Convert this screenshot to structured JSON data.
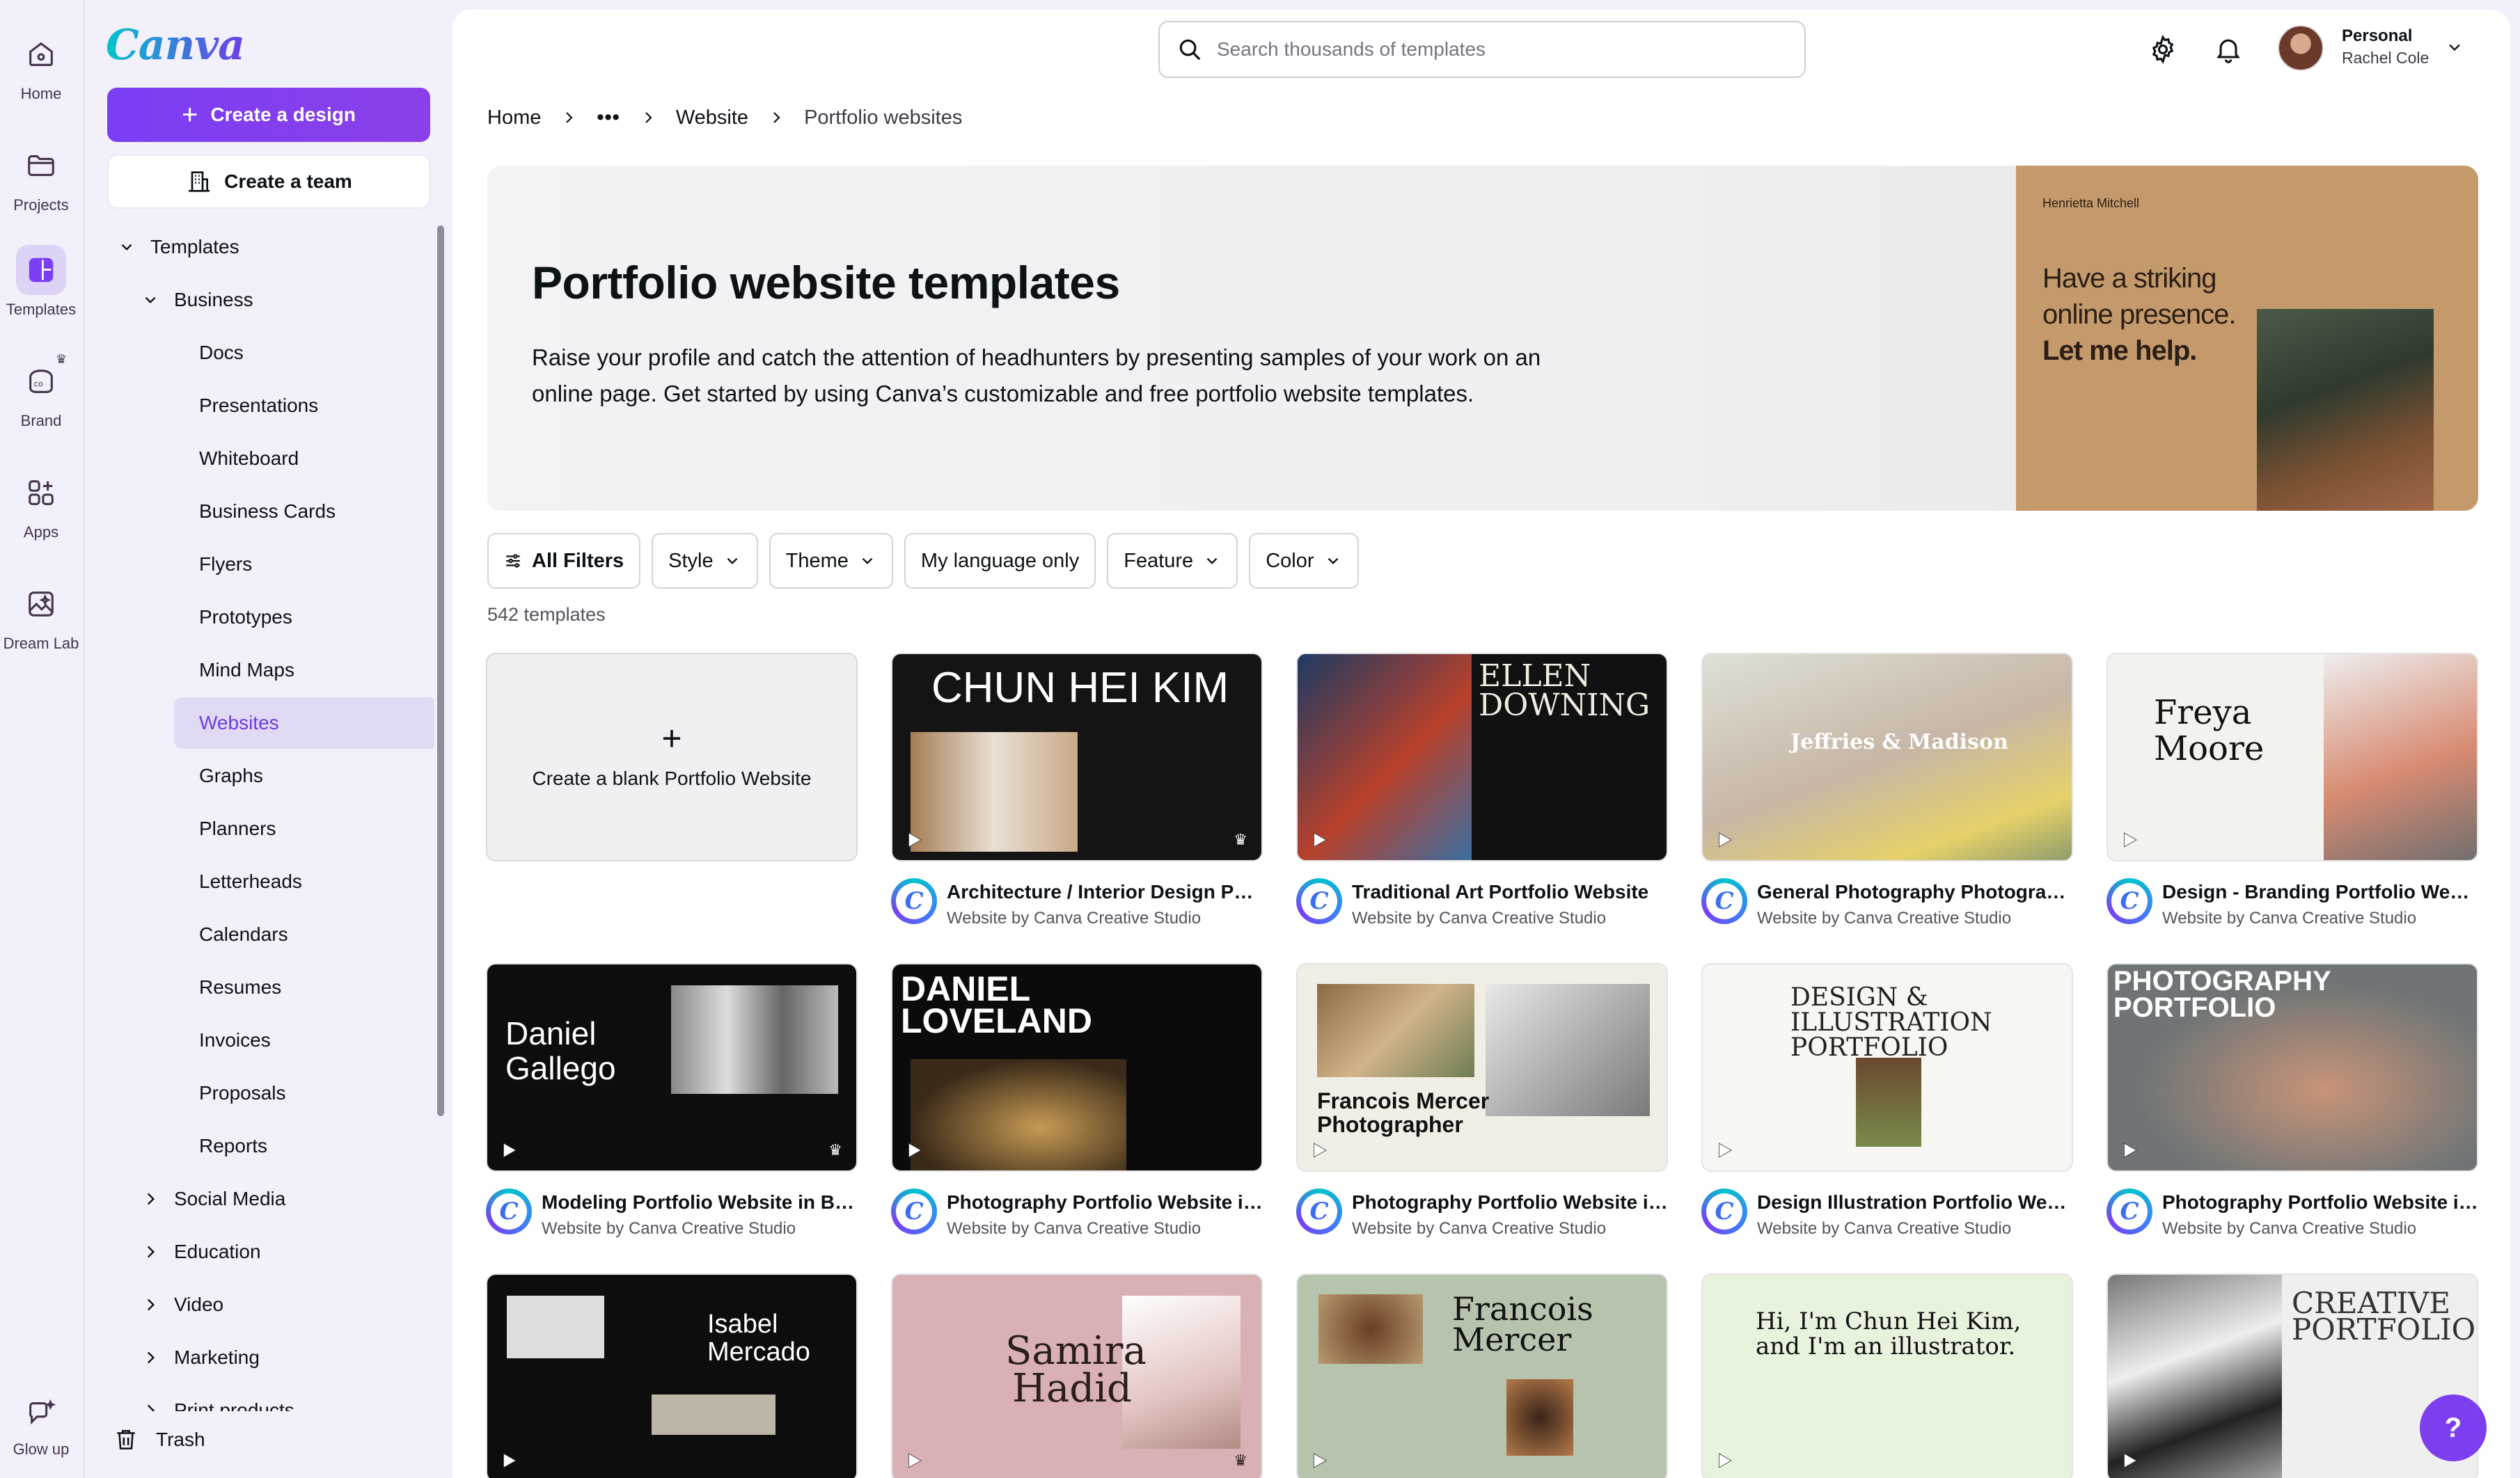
{
  "rail": [
    {
      "label": "Home",
      "icon": "home-icon"
    },
    {
      "label": "Projects",
      "icon": "folder-icon"
    },
    {
      "label": "Templates",
      "icon": "templates-icon"
    },
    {
      "label": "Brand",
      "icon": "brand-icon"
    },
    {
      "label": "Apps",
      "icon": "apps-icon"
    },
    {
      "label": "Dream Lab",
      "icon": "dream-lab-icon"
    },
    {
      "label": "Glow up",
      "icon": "glow-up-icon"
    }
  ],
  "sidebar": {
    "logo": "Canva",
    "create_design": "Create a design",
    "create_team": "Create a team",
    "tree": [
      {
        "label": "Templates",
        "level": 0,
        "chevron": "down"
      },
      {
        "label": "Business",
        "level": 1,
        "chevron": "down"
      },
      {
        "label": "Docs",
        "level": 2
      },
      {
        "label": "Presentations",
        "level": 2
      },
      {
        "label": "Whiteboard",
        "level": 2
      },
      {
        "label": "Business Cards",
        "level": 2
      },
      {
        "label": "Flyers",
        "level": 2
      },
      {
        "label": "Prototypes",
        "level": 2
      },
      {
        "label": "Mind Maps",
        "level": 2
      },
      {
        "label": "Websites",
        "level": 2,
        "active": true
      },
      {
        "label": "Graphs",
        "level": 2
      },
      {
        "label": "Planners",
        "level": 2
      },
      {
        "label": "Letterheads",
        "level": 2
      },
      {
        "label": "Calendars",
        "level": 2
      },
      {
        "label": "Resumes",
        "level": 2
      },
      {
        "label": "Invoices",
        "level": 2
      },
      {
        "label": "Proposals",
        "level": 2
      },
      {
        "label": "Reports",
        "level": 2
      },
      {
        "label": "Social Media",
        "level": 1,
        "chevron": "right"
      },
      {
        "label": "Education",
        "level": 1,
        "chevron": "right"
      },
      {
        "label": "Video",
        "level": 1,
        "chevron": "right"
      },
      {
        "label": "Marketing",
        "level": 1,
        "chevron": "right"
      },
      {
        "label": "Print products",
        "level": 1,
        "chevron": "right"
      }
    ],
    "trash": "Trash"
  },
  "header": {
    "search_placeholder": "Search thousands of templates",
    "account_type": "Personal",
    "account_name": "Rachel Cole"
  },
  "breadcrumb": {
    "home": "Home",
    "more": "•••",
    "website": "Website",
    "current": "Portfolio websites"
  },
  "hero": {
    "title": "Portfolio website templates",
    "description": "Raise your profile and catch the attention of headhunters by presenting samples of your work on an online page. Get started by using Canva’s customizable and free portfolio website templates.",
    "preview_name": "Henrietta Mitchell",
    "preview_lines": [
      "Have a striking",
      "online presence.",
      "Let me help."
    ]
  },
  "filters": [
    "All Filters",
    "Style",
    "Theme",
    "My language only",
    "Feature",
    "Color"
  ],
  "count": "542 templates",
  "blank_card": "Create a blank Portfolio Website",
  "creator": "Website by Canva Creative Studio",
  "templates": [
    {
      "title": "Architecture / Interior Design Portfolio Website",
      "thumb": [
        "CHUN HEI KIM"
      ],
      "pro": true
    },
    {
      "title": "Traditional Art Portfolio Website",
      "thumb": [
        "ELLEN",
        "DOWNING"
      ],
      "pro": false
    },
    {
      "title": "General Photography Photographer Portfolio Website",
      "thumb": [
        "Jeffries & Madison"
      ],
      "pro": false
    },
    {
      "title": "Design - Branding Portfolio Website",
      "thumb": [
        "Freya",
        "Moore"
      ],
      "pro": false
    },
    {
      "title": "Modeling Portfolio Website in Black and White",
      "thumb": [
        "Daniel",
        "Gallego"
      ],
      "pro": true
    },
    {
      "title": "Photography Portfolio Website in Black",
      "thumb": [
        "DANIEL",
        "LOVELAND"
      ],
      "pro": false
    },
    {
      "title": "Photography Portfolio Website in Cream",
      "thumb": [
        "Francois Mercer",
        "Photographer"
      ],
      "pro": false
    },
    {
      "title": "Design Illustration Portfolio Website",
      "thumb": [
        "DESIGN &",
        "ILLUSTRATION",
        "PORTFOLIO"
      ],
      "pro": false
    },
    {
      "title": "Photography Portfolio Website in Grey",
      "thumb": [
        "PHOTOGRAPHY",
        "PORTFOLIO"
      ],
      "pro": false
    },
    {
      "title": "",
      "thumb": [
        "Isabel",
        "Mercado"
      ],
      "pro": false
    },
    {
      "title": "",
      "thumb": [
        "Samira",
        "Hadid"
      ],
      "pro": true
    },
    {
      "title": "",
      "thumb": [
        "Francois",
        "Mercer"
      ],
      "pro": false
    },
    {
      "title": "",
      "thumb": [
        "Hi, I'm Chun Hei Kim,",
        "and I'm an illustrator."
      ],
      "pro": false
    },
    {
      "title": "",
      "thumb": [
        "CREATIVE",
        "PORTFOLIO"
      ],
      "pro": false
    }
  ],
  "help": "?"
}
